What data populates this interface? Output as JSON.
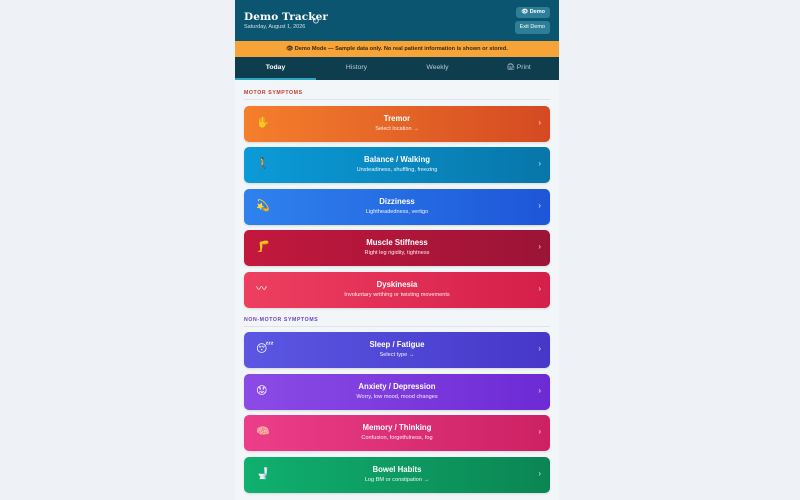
{
  "header": {
    "title": "Demo Tracker",
    "date": "Saturday, August 1, 2026",
    "refresh_icon": "↻",
    "demo_badge": "👁 Demo",
    "exit_label": "Exit Demo"
  },
  "banner": {
    "text": "👁 Demo Mode — Sample data only. No real patient information is shown or stored."
  },
  "tabs": [
    {
      "label": "Today"
    },
    {
      "label": "History"
    },
    {
      "label": "Weekly"
    },
    {
      "label": "🖨 Print"
    }
  ],
  "sections": {
    "motor": "MOTOR SYMPTOMS",
    "nonmotor": "NON-MOTOR SYMPTOMS"
  },
  "cards": [
    {
      "icon": "✋",
      "icon_name": "hand-icon",
      "name": "Tremor",
      "sub": "Select location →",
      "from": "#f57f2c",
      "to": "#d44a22"
    },
    {
      "icon": "🚶",
      "icon_name": "walking-icon",
      "name": "Balance / Walking",
      "sub": "Unsteadiness, shuffling, freezing",
      "from": "#0b9bd8",
      "to": "#0876a8"
    },
    {
      "icon": "💫",
      "icon_name": "dizzy-icon",
      "name": "Dizziness",
      "sub": "Lightheadedness, vertigo",
      "from": "#2f82ee",
      "to": "#1d56d8"
    },
    {
      "icon": "🦵",
      "icon_name": "leg-icon",
      "name": "Muscle Stiffness",
      "sub": "Right leg rigidity, tightness",
      "from": "#c3183e",
      "to": "#9b1436"
    },
    {
      "icon": "〰",
      "icon_name": "wave-icon",
      "name": "Dyskinesia",
      "sub": "Involuntary writhing or twisting movements",
      "from": "#ee3f60",
      "to": "#d41f4a"
    },
    {
      "icon": "😴",
      "icon_name": "sleep-icon",
      "name": "Sleep / Fatigue",
      "sub": "Select type →",
      "from": "#5b57e3",
      "to": "#4637c8"
    },
    {
      "icon": "😟",
      "icon_name": "worried-icon",
      "name": "Anxiety / Depression",
      "sub": "Worry, low mood, mood changes",
      "from": "#8b4be6",
      "to": "#6d2ad4"
    },
    {
      "icon": "🧠",
      "icon_name": "brain-icon",
      "name": "Memory / Thinking",
      "sub": "Confusion, forgetfulness, fog",
      "from": "#ec3e8a",
      "to": "#cc2163"
    },
    {
      "icon": "🚽",
      "icon_name": "toilet-icon",
      "name": "Bowel Habits",
      "sub": "Log BM or constipation →",
      "from": "#10b06f",
      "to": "#0b8553"
    }
  ],
  "chevron": "›"
}
